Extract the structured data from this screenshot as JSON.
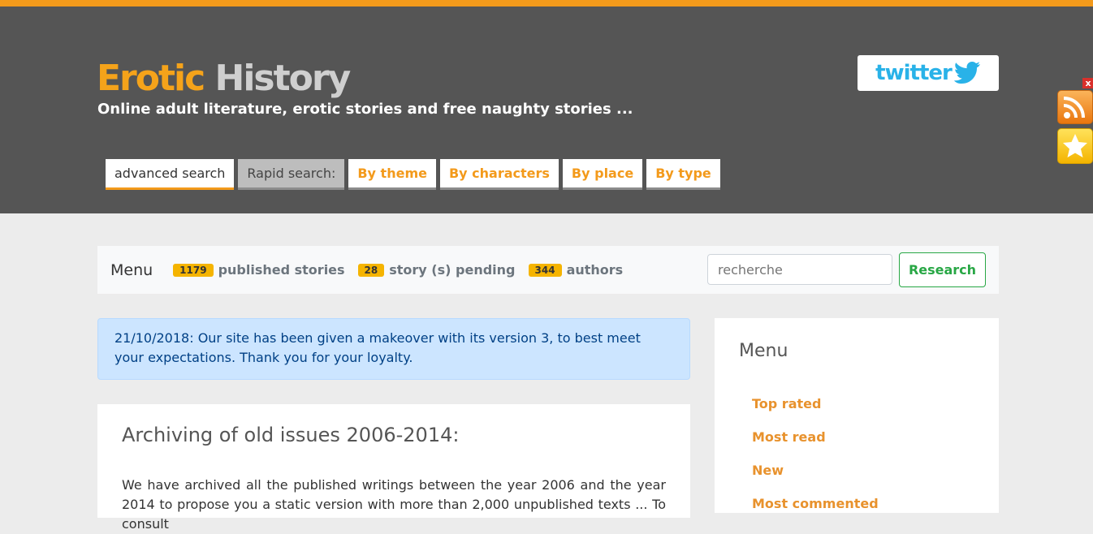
{
  "header": {
    "logo_word1": "Erotic",
    "logo_word2": "History",
    "tagline": "Online adult literature, erotic stories and free naughty stories ...",
    "twitter_label": "twitter"
  },
  "tabs": [
    {
      "label": "advanced search"
    },
    {
      "label": "Rapid search:"
    },
    {
      "label": "By theme"
    },
    {
      "label": "By characters"
    },
    {
      "label": "By place"
    },
    {
      "label": "By type"
    }
  ],
  "side_icons": {
    "close": "x",
    "rss": "rss-icon",
    "favorite": "star-icon"
  },
  "menubar": {
    "label": "Menu",
    "stats": [
      {
        "count": "1179",
        "label": "published stories"
      },
      {
        "count": "28",
        "label": "story (s) pending"
      },
      {
        "count": "344",
        "label": "authors"
      }
    ],
    "search_placeholder": "recherche",
    "search_button": "Research"
  },
  "alert": {
    "text": "21/10/2018: Our site has been given a makeover with its version 3, to best meet your expectations. Thank you for your loyalty."
  },
  "article": {
    "title": "Archiving of old issues 2006-2014:",
    "body": "We have archived all the published writings between the year 2006 and the year 2014 to propose you a static version with more than 2,000 unpublished texts ... To consult"
  },
  "sidebar": {
    "title": "Menu",
    "items": [
      "Top rated",
      "Most read",
      "New",
      "Most commented"
    ]
  },
  "colors": {
    "accent": "#f39a1b",
    "header_bg": "#555555",
    "success": "#28a745",
    "badge": "#f5b400"
  }
}
